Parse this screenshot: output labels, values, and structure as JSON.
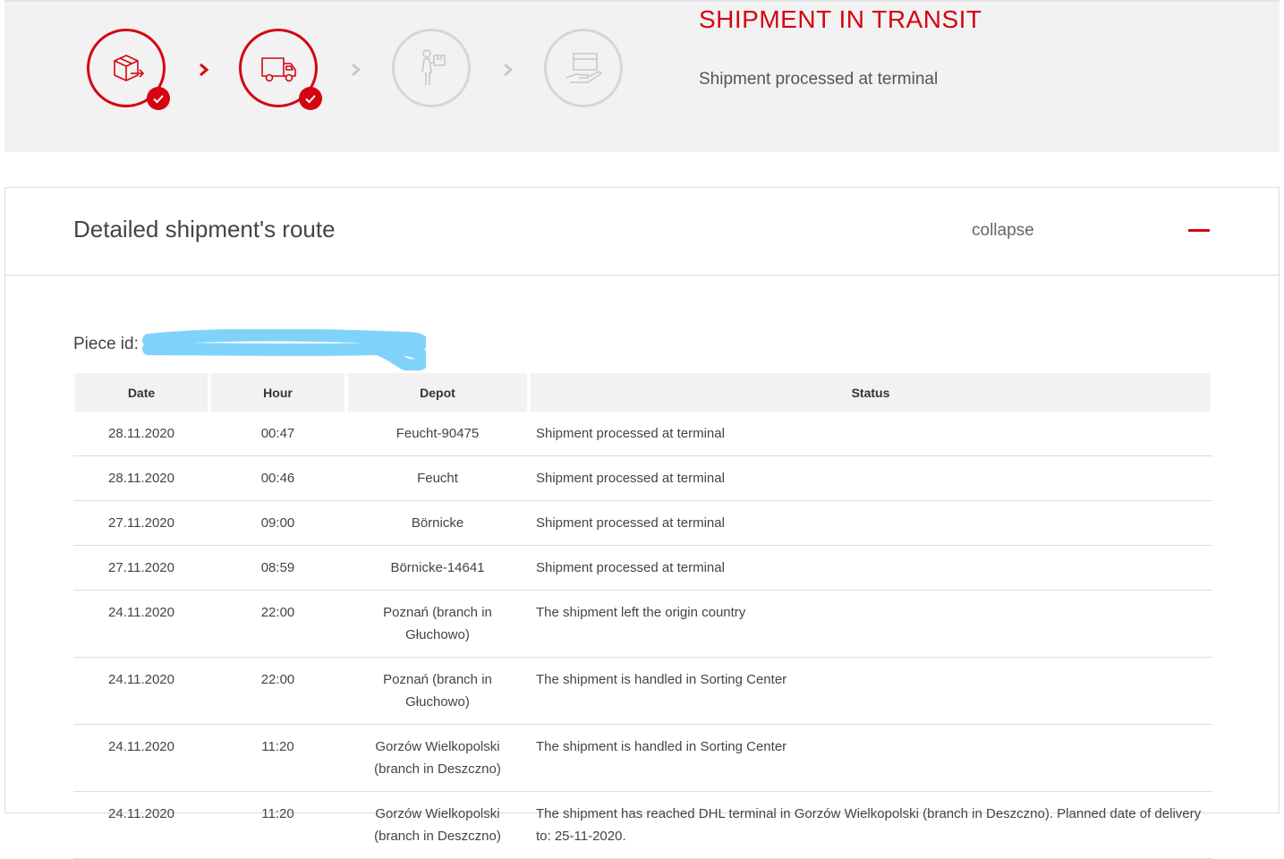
{
  "progress": {
    "steps": [
      {
        "name": "shipment-prepared",
        "icon": "package-send-icon",
        "done": true
      },
      {
        "name": "in-transit",
        "icon": "truck-icon",
        "done": true
      },
      {
        "name": "courier",
        "icon": "courier-icon",
        "done": false
      },
      {
        "name": "delivered",
        "icon": "hand-package-icon",
        "done": false
      }
    ],
    "status_title": "SHIPMENT IN TRANSIT",
    "status_subtitle": "Shipment processed at terminal"
  },
  "route": {
    "title": "Detailed shipment's route",
    "collapse_label": "collapse",
    "piece_label": "Piece id:",
    "columns": [
      "Date",
      "Hour",
      "Depot",
      "Status"
    ],
    "rows": [
      {
        "date": "28.11.2020",
        "hour": "00:47",
        "depot": "Feucht-90475",
        "status": "Shipment processed at terminal"
      },
      {
        "date": "28.11.2020",
        "hour": "00:46",
        "depot": "Feucht",
        "status": "Shipment processed at terminal"
      },
      {
        "date": "27.11.2020",
        "hour": "09:00",
        "depot": "Börnicke",
        "status": "Shipment processed at terminal"
      },
      {
        "date": "27.11.2020",
        "hour": "08:59",
        "depot": "Börnicke-14641",
        "status": "Shipment processed at terminal"
      },
      {
        "date": "24.11.2020",
        "hour": "22:00",
        "depot": "Poznań (branch in Głuchowo)",
        "status": "The shipment left the origin country"
      },
      {
        "date": "24.11.2020",
        "hour": "22:00",
        "depot": "Poznań (branch in Głuchowo)",
        "status": "The shipment is handled in Sorting Center"
      },
      {
        "date": "24.11.2020",
        "hour": "11:20",
        "depot": "Gorzów Wielkopolski (branch in Deszczno)",
        "status": "The shipment is handled in Sorting Center"
      },
      {
        "date": "24.11.2020",
        "hour": "11:20",
        "depot": "Gorzów Wielkopolski (branch in Deszczno)",
        "status": "The shipment has reached DHL terminal in Gorzów Wielkopolski (branch in Deszczno).  Planned date of delivery to: 25-11-2020."
      }
    ]
  },
  "colors": {
    "accent": "#d40511",
    "inactive": "#d6d6d6",
    "panel": "#f2f2f2",
    "redaction": "#7fd3fa"
  }
}
